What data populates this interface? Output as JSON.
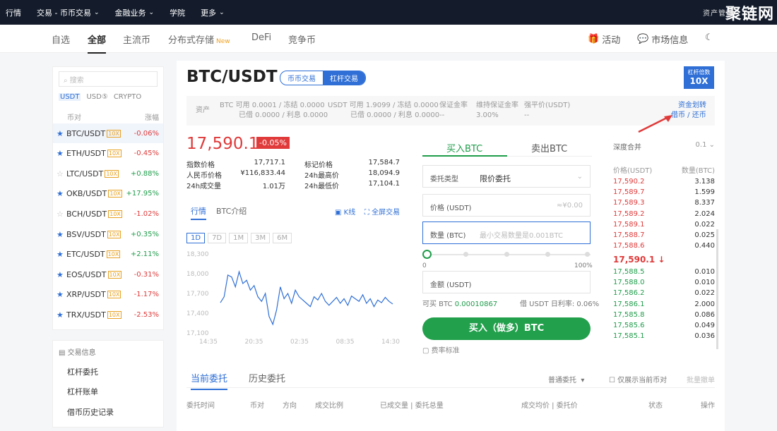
{
  "topnav": [
    {
      "label": "行情",
      "caret": false
    },
    {
      "label": "交易 - 币币交易",
      "caret": true
    },
    {
      "label": "金融业务",
      "caret": true
    },
    {
      "label": "学院",
      "caret": false
    },
    {
      "label": "更多",
      "caret": true
    }
  ],
  "watermark": {
    "text": "聚链网",
    "assets_label": "资产管理"
  },
  "subnav": {
    "tabs": [
      "自选",
      "全部",
      "主流币",
      "分布式存储",
      "DeFi",
      "竞争币"
    ],
    "new_badge": "New",
    "activity": "活动",
    "market_info": "市场信息"
  },
  "left": {
    "search_placeholder": "搜索",
    "quote_tabs": [
      "USDT",
      "USD⑤",
      "CRYPTO"
    ],
    "head_pair": "币对",
    "head_change": "涨幅",
    "lev": "10X",
    "rows": [
      {
        "pair": "BTC/USDT",
        "change": "-0.06%",
        "dir": "dn",
        "star": true
      },
      {
        "pair": "ETH/USDT",
        "change": "-0.45%",
        "dir": "dn",
        "star": true
      },
      {
        "pair": "LTC/USDT",
        "change": "+0.88%",
        "dir": "up",
        "star": false
      },
      {
        "pair": "OKB/USDT",
        "change": "+17.95%",
        "dir": "up",
        "star": true
      },
      {
        "pair": "BCH/USDT",
        "change": "-1.02%",
        "dir": "dn",
        "star": false
      },
      {
        "pair": "BSV/USDT",
        "change": "+0.35%",
        "dir": "up",
        "star": true
      },
      {
        "pair": "ETC/USDT",
        "change": "+2.11%",
        "dir": "up",
        "star": true
      },
      {
        "pair": "EOS/USDT",
        "change": "-0.31%",
        "dir": "dn",
        "star": true
      },
      {
        "pair": "XRP/USDT",
        "change": "-1.17%",
        "dir": "dn",
        "star": true
      },
      {
        "pair": "TRX/USDT",
        "change": "-2.53%",
        "dir": "dn",
        "star": true
      }
    ]
  },
  "info": {
    "title": "交易信息",
    "items": [
      "杠杆委托",
      "杠杆账单",
      "借币历史记录"
    ]
  },
  "header": {
    "pair": "BTC/USDT",
    "seg": [
      "币币交易",
      "杠杆交易"
    ],
    "lev_label": "杠杆倍数",
    "lev_value": "10X"
  },
  "assets": {
    "label": "资产",
    "btc_a": "BTC  可用 0.0001 / 冻结 0.0000",
    "btc_b": "已借 0.0000 / 利息 0.0000",
    "usdt_a": "USDT  可用 1.9099 / 冻结 0.0000",
    "usdt_b": "已借 0.0000 / 利息 0.0000",
    "margin_l": "保证金率",
    "margin_v": "--",
    "maint_l": "维持保证金率",
    "maint_v": "3.00%",
    "liq_l": "强平价(USDT)",
    "liq_v": "--",
    "transfer": "资金划转",
    "borrow": "借币 / 还币"
  },
  "ticker": {
    "price": "17,590.1",
    "pct": "-0.05%",
    "rows": [
      [
        "指数价格",
        "17,717.1",
        "标记价格",
        "17,584.7"
      ],
      [
        "人民币价格",
        "¥116,833.44",
        "24h最高价",
        "18,094.9"
      ],
      [
        "24h成交量",
        "1.01万",
        "24h最低价",
        "17,104.1"
      ]
    ]
  },
  "chart_tabs": {
    "t1": "行情",
    "t2": "BTC介绍",
    "kline": "K线",
    "full": "全屏交易",
    "ranges": [
      "1D",
      "7D",
      "1M",
      "3M",
      "6M"
    ]
  },
  "chart_data": {
    "type": "line",
    "x": [
      "14:35",
      "20:35",
      "02:35",
      "08:35",
      "14:30"
    ],
    "y_ticks": [
      "18,300",
      "18,000",
      "17,700",
      "17,400",
      "17,100"
    ],
    "ylim": [
      17100,
      18300
    ],
    "values": [
      17560,
      17650,
      17980,
      17950,
      17800,
      18030,
      17850,
      17900,
      17750,
      17820,
      17650,
      17580,
      17700,
      17350,
      17230,
      17450,
      17800,
      17620,
      17700,
      17550,
      17750,
      17650,
      17600,
      17550,
      17500,
      17650,
      17600,
      17700,
      17580,
      17520,
      17580,
      17640,
      17550,
      17620,
      17520,
      17660,
      17620,
      17580,
      17680,
      17550,
      17620,
      17500,
      17600,
      17560,
      17640,
      17580,
      17540
    ]
  },
  "trade": {
    "buy_tab": "买入BTC",
    "sell_tab": "卖出BTC",
    "type_label": "委托类型",
    "type_value": "限价委托",
    "price_label": "价格 (USDT)",
    "price_suffix": "≈¥0.00",
    "qty_label": "数量 (BTC)",
    "qty_placeholder": "最小交易数量是0.001BTC",
    "s0": "0",
    "s100": "100%",
    "amount_label": "金额 (USDT)",
    "avail": "可买 BTC",
    "avail_v": "0.00010867",
    "rate": "借 USDT 日利率: 0.06%",
    "buy_btn": "买入（做多）BTC",
    "fee": "费率标准"
  },
  "orderbook": {
    "depth": "深度合并",
    "depth_v": "0.1",
    "col_p": "价格(USDT)",
    "col_q": "数量(BTC)",
    "asks": [
      [
        "17,590.2",
        "3.138"
      ],
      [
        "17,589.7",
        "1.599"
      ],
      [
        "17,589.3",
        "8.337"
      ],
      [
        "17,589.2",
        "2.024"
      ],
      [
        "17,589.1",
        "0.022"
      ],
      [
        "17,588.7",
        "0.025"
      ],
      [
        "17,588.6",
        "0.440"
      ]
    ],
    "mid": "17,590.1 ↓",
    "bids": [
      [
        "17,588.5",
        "0.010"
      ],
      [
        "17,588.0",
        "0.010"
      ],
      [
        "17,586.2",
        "0.022"
      ],
      [
        "17,586.1",
        "2.000"
      ],
      [
        "17,585.8",
        "0.086"
      ],
      [
        "17,585.6",
        "0.049"
      ],
      [
        "17,585.1",
        "0.036"
      ]
    ]
  },
  "orders": {
    "t1": "当前委托",
    "t2": "历史委托",
    "type": "普通委托",
    "only": "仅展示当前币对",
    "cancel": "批量撤单",
    "cols": [
      "委托时间",
      "币对",
      "方向",
      "成交比例",
      "已成交量 | 委托总量",
      "成交均价 | 委托价",
      "状态",
      "操作"
    ]
  }
}
